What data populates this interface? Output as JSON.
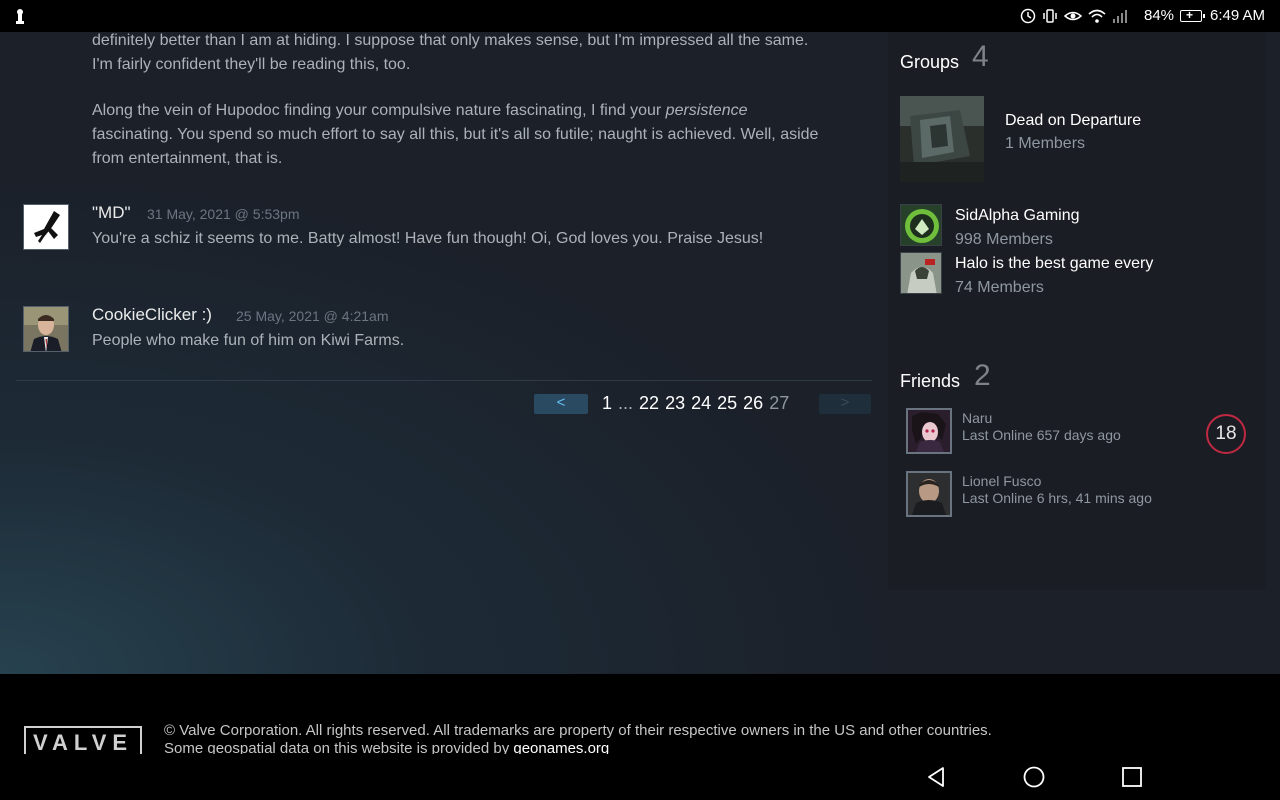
{
  "status_bar": {
    "battery_pct": "84%",
    "time": "6:49 AM"
  },
  "comments_section": {
    "paragraph1": "definitely better than I am at hiding. I suppose that only makes sense, but I'm impressed all the same. I'm fairly confident they'll be reading this, too.",
    "paragraph2_start": "Along the vein of Hupodoc finding your compulsive nature fascinating, I find your ",
    "paragraph2_em": "persistence",
    "paragraph2_end": " fascinating. You spend so much effort to say all this, but it's all so futile; naught is achieved. Well, aside from entertainment, that is.",
    "comments": [
      {
        "author": "\"MD\"",
        "timestamp": "31 May, 2021 @ 5:53pm",
        "text": "You're a schiz it seems to me. Batty almost! Have fun though! Oi, God loves you. Praise Jesus!"
      },
      {
        "author": "CookieClicker :)",
        "timestamp": "25 May, 2021 @ 4:21am",
        "text": "People who make fun of him on Kiwi Farms."
      }
    ]
  },
  "pagination": {
    "prev": "<",
    "next": ">",
    "pages": [
      "1",
      "...",
      "22",
      "23",
      "24",
      "25",
      "26",
      "27"
    ]
  },
  "sidebar": {
    "groups_title": "Groups",
    "groups_count": "4",
    "groups": [
      {
        "name": "Dead on Departure",
        "members": "1 Members"
      },
      {
        "name": "SidAlpha Gaming",
        "members": "998 Members"
      },
      {
        "name": "Halo is the best game every",
        "members": "74 Members"
      }
    ],
    "friends_title": "Friends",
    "friends_count": "2",
    "friends": [
      {
        "name": "Naru",
        "status": "Last Online 657 days ago"
      },
      {
        "name": "Lionel Fusco",
        "status": "Last Online 6 hrs, 41 mins ago"
      }
    ],
    "level": "18"
  },
  "footer": {
    "logo": "VALVE",
    "copyright": "© Valve Corporation. All rights reserved. All trademarks are property of their respective owners in the US and other countries.",
    "geodata_prefix": "Some geospatial data on this website is provided by ",
    "geodata_link": "geonames.org"
  },
  "colors": {
    "accent_blue": "#66c0f4",
    "level_ring": "#c02942"
  }
}
